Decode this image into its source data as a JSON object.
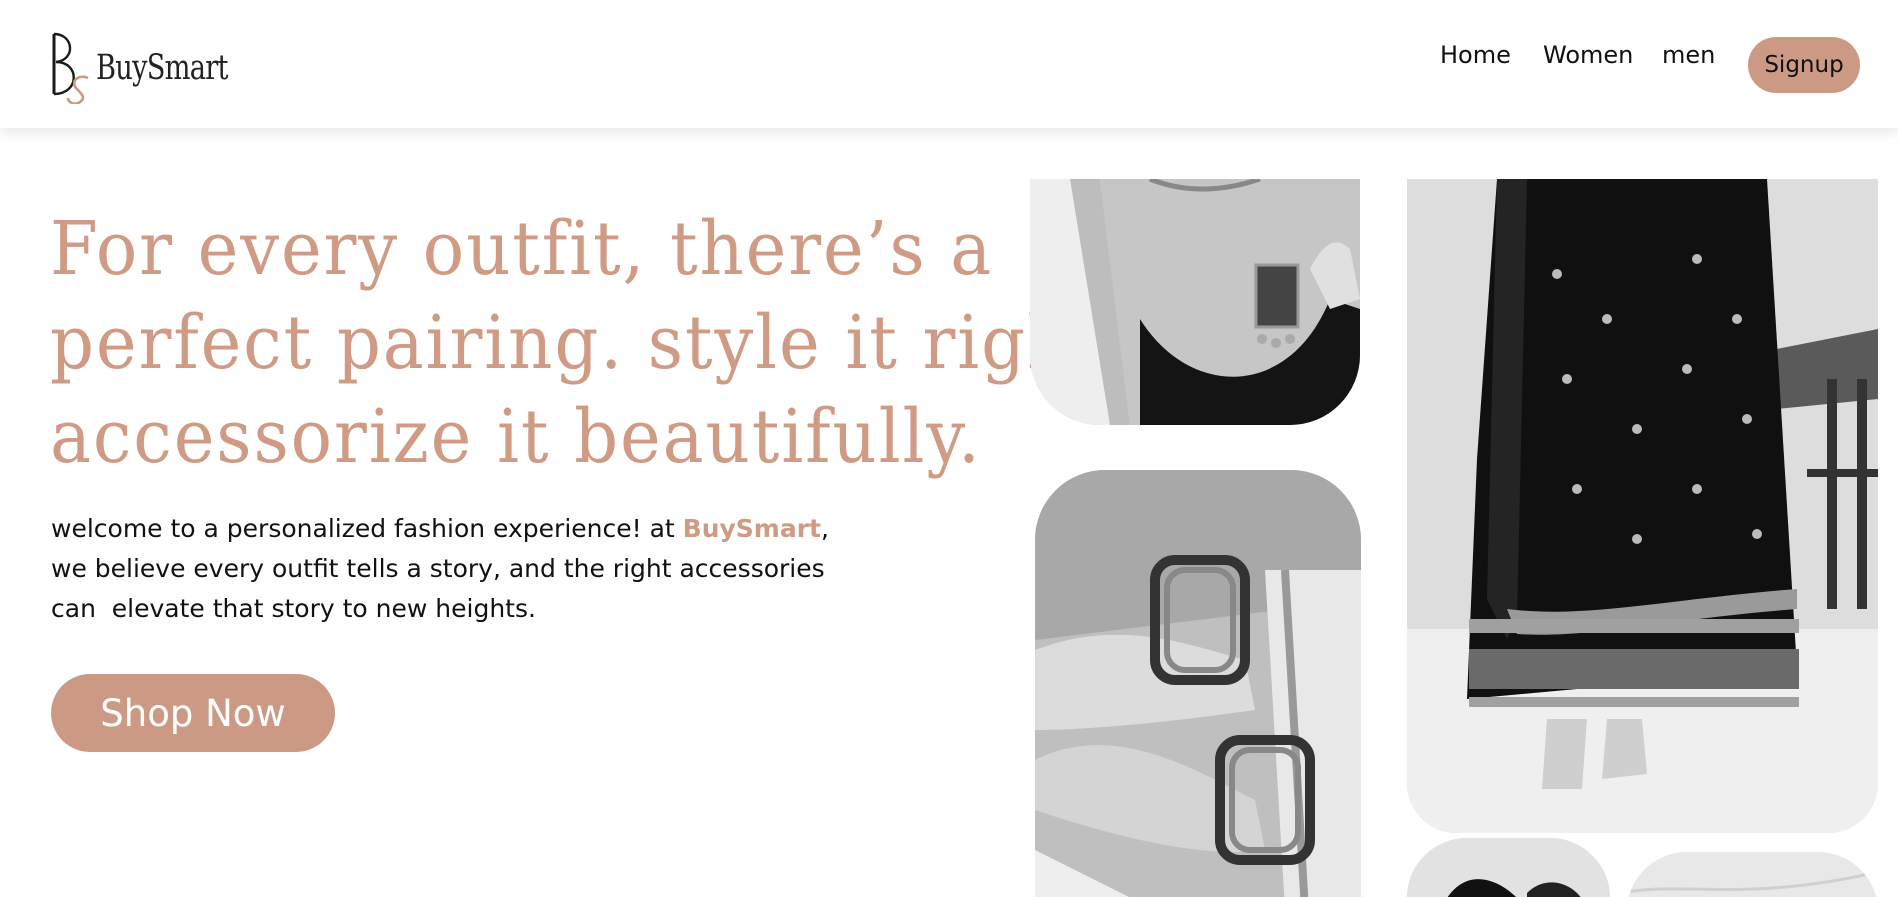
{
  "brand": {
    "logo_text": "BuySmart",
    "accent_color": "#cc9a84"
  },
  "nav": {
    "items": [
      {
        "label": "Home"
      },
      {
        "label": "Women"
      },
      {
        "label": "men"
      }
    ],
    "signup_label": "Signup"
  },
  "hero": {
    "headline_lines": [
      "For every outfit, there’s a",
      "perfect pairing. style it right.",
      "accessorize it beautifully."
    ],
    "intro": {
      "line1_prefix": "welcome to a personalized fashion experience! at ",
      "brand": "BuySmart",
      "line1_suffix": ",",
      "line2": "we believe every outfit tells a story, and the right accessories",
      "line3": "can  elevate that story to new heights."
    },
    "cta_label": "Shop Now"
  },
  "gallery": {
    "images": [
      {
        "name": "necklace-pendant-photo"
      },
      {
        "name": "bangles-photo"
      },
      {
        "name": "velvet-suit-photo"
      },
      {
        "name": "shoes-photo"
      },
      {
        "name": "marble-photo"
      }
    ]
  }
}
